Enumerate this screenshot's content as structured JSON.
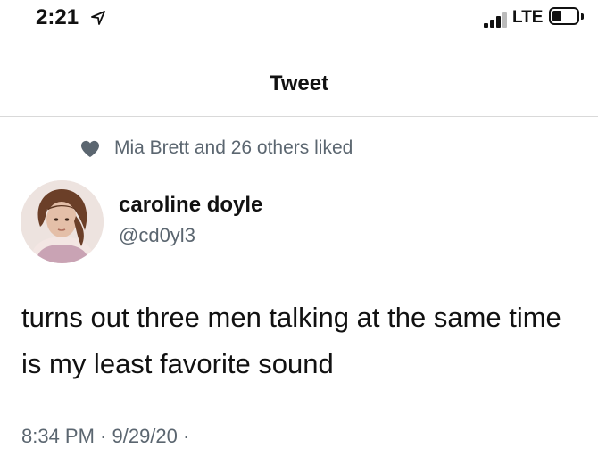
{
  "status_bar": {
    "time": "2:21",
    "carrier": "LTE",
    "icons": [
      "location-arrow-icon",
      "signal-bars-icon",
      "battery-icon"
    ]
  },
  "header": {
    "title": "Tweet"
  },
  "social_context": {
    "text": "Mia Brett and 26 others liked",
    "icon": "heart-icon"
  },
  "author": {
    "display_name": "caroline doyle",
    "handle": "@cd0yl3"
  },
  "tweet": {
    "text": "turns out three men talking at the same time is my least favorite sound",
    "timestamp": "8:34 PM · 9/29/20 ·"
  },
  "colors": {
    "text": "#111111",
    "secondary": "#5b6670",
    "divider": "#d9d9d9"
  }
}
